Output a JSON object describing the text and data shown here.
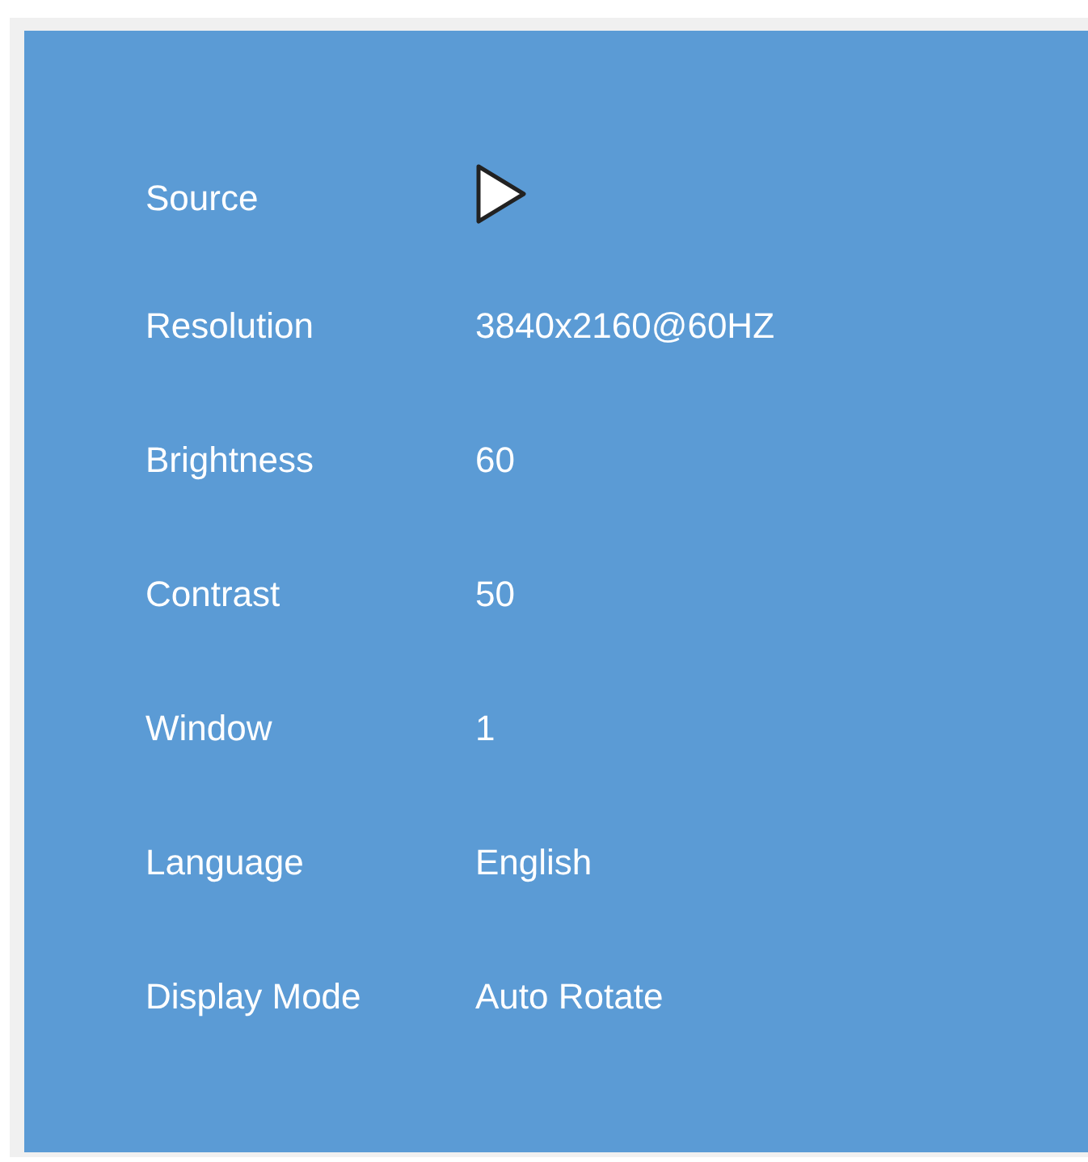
{
  "menu": [
    {
      "label": "Source",
      "kind": "submenu"
    },
    {
      "label": "Resolution",
      "kind": "value",
      "value": "3840x2160@60HZ"
    },
    {
      "label": "Brightness",
      "kind": "value",
      "value": "60"
    },
    {
      "label": "Contrast",
      "kind": "value",
      "value": "50"
    },
    {
      "label": "Window",
      "kind": "value",
      "value": "1"
    },
    {
      "label": "Language",
      "kind": "value",
      "value": "English"
    },
    {
      "label": "Display Mode",
      "kind": "value",
      "value": "Auto Rotate"
    }
  ]
}
